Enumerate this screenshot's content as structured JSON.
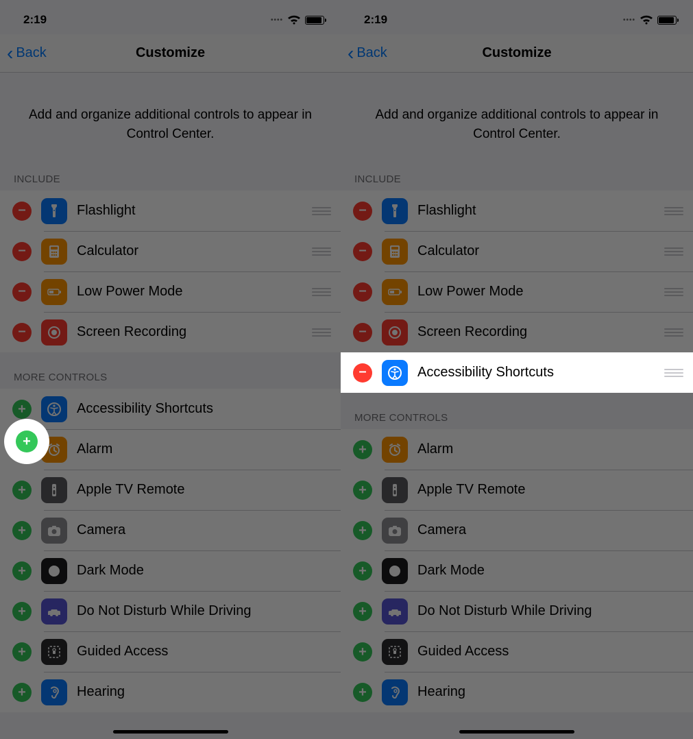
{
  "status": {
    "time": "2:19"
  },
  "nav": {
    "back": "Back",
    "title": "Customize"
  },
  "description": "Add and organize additional controls to appear in Control Center.",
  "sections": {
    "include": "INCLUDE",
    "more": "MORE CONTROLS"
  },
  "left": {
    "include": [
      {
        "name": "Flashlight",
        "icon": "flashlight",
        "bg": "ic-flashlight"
      },
      {
        "name": "Calculator",
        "icon": "calculator",
        "bg": "ic-calc"
      },
      {
        "name": "Low Power Mode",
        "icon": "lowpower",
        "bg": "ic-lowpower"
      },
      {
        "name": "Screen Recording",
        "icon": "screenrec",
        "bg": "ic-screenrec"
      }
    ],
    "more": [
      {
        "name": "Accessibility Shortcuts",
        "icon": "access",
        "bg": "ic-access"
      },
      {
        "name": "Alarm",
        "icon": "alarm",
        "bg": "ic-alarm"
      },
      {
        "name": "Apple TV Remote",
        "icon": "tvremote",
        "bg": "ic-tvremote"
      },
      {
        "name": "Camera",
        "icon": "camera",
        "bg": "ic-camera"
      },
      {
        "name": "Dark Mode",
        "icon": "darkmode",
        "bg": "ic-darkmode"
      },
      {
        "name": "Do Not Disturb While Driving",
        "icon": "dnd",
        "bg": "ic-dnd"
      },
      {
        "name": "Guided Access",
        "icon": "guided",
        "bg": "ic-guided"
      },
      {
        "name": "Hearing",
        "icon": "hearing",
        "bg": "ic-hearing"
      }
    ]
  },
  "right": {
    "include": [
      {
        "name": "Flashlight",
        "icon": "flashlight",
        "bg": "ic-flashlight"
      },
      {
        "name": "Calculator",
        "icon": "calculator",
        "bg": "ic-calc"
      },
      {
        "name": "Low Power Mode",
        "icon": "lowpower",
        "bg": "ic-lowpower"
      },
      {
        "name": "Screen Recording",
        "icon": "screenrec",
        "bg": "ic-screenrec"
      },
      {
        "name": "Accessibility Shortcuts",
        "icon": "access",
        "bg": "ic-access"
      }
    ],
    "more": [
      {
        "name": "Alarm",
        "icon": "alarm",
        "bg": "ic-alarm"
      },
      {
        "name": "Apple TV Remote",
        "icon": "tvremote",
        "bg": "ic-tvremote"
      },
      {
        "name": "Camera",
        "icon": "camera",
        "bg": "ic-camera"
      },
      {
        "name": "Dark Mode",
        "icon": "darkmode",
        "bg": "ic-darkmode"
      },
      {
        "name": "Do Not Disturb While Driving",
        "icon": "dnd",
        "bg": "ic-dnd"
      },
      {
        "name": "Guided Access",
        "icon": "guided",
        "bg": "ic-guided"
      },
      {
        "name": "Hearing",
        "icon": "hearing",
        "bg": "ic-hearing"
      }
    ],
    "highlightIndex": 4
  }
}
